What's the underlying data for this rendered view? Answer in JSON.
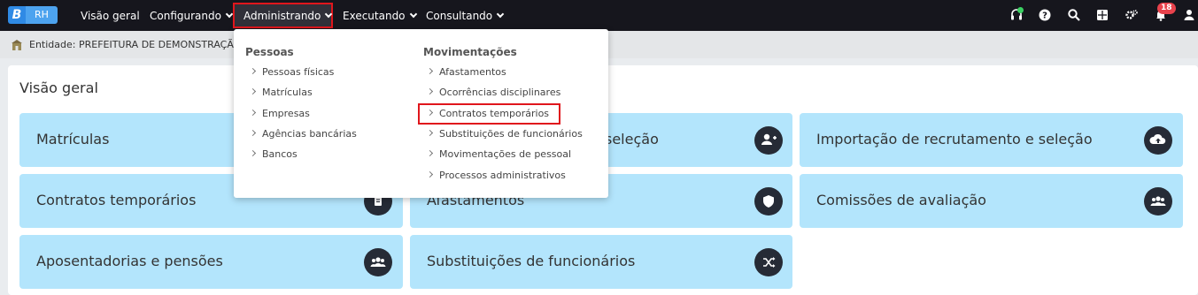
{
  "app": {
    "logo_letter": "B",
    "logo_label": "RH"
  },
  "nav": {
    "items": [
      {
        "label": "Visão geral"
      },
      {
        "label": "Configurando"
      },
      {
        "label": "Administrando"
      },
      {
        "label": "Executando"
      },
      {
        "label": "Consultando"
      }
    ]
  },
  "topbar": {
    "notification_count": "18",
    "icons": [
      "headset-icon",
      "help-icon",
      "search-icon",
      "apps-icon",
      "settings-icon",
      "bell-icon",
      "user-icon"
    ]
  },
  "entity": {
    "label": "Entidade: PREFEITURA DE DEMONSTRAÇÃO I"
  },
  "main": {
    "title": "Visão geral"
  },
  "cards": [
    {
      "label": "Matrículas",
      "icon": "user-icon"
    },
    {
      "label": "seleção",
      "icon": "user-plus-icon"
    },
    {
      "label": "Importação de recrutamento e seleção",
      "icon": "cloud-upload-icon"
    },
    {
      "label": "Contratos temporários",
      "icon": "document-icon"
    },
    {
      "label": "Afastamentos",
      "icon": "shield-icon"
    },
    {
      "label": "Comissões de avaliação",
      "icon": "users-icon"
    },
    {
      "label": "Aposentadorias e pensões",
      "icon": "users-icon"
    },
    {
      "label": "Substituições de funcionários",
      "icon": "shuffle-icon"
    }
  ],
  "dropdown": {
    "pessoas": {
      "title": "Pessoas",
      "items": [
        "Pessoas físicas",
        "Matrículas",
        "Empresas",
        "Agências bancárias",
        "Bancos"
      ]
    },
    "movimentacoes": {
      "title": "Movimentações",
      "items": [
        "Afastamentos",
        "Ocorrências disciplinares",
        "Contratos temporários",
        "Substituições de funcionários",
        "Movimentações de pessoal",
        "Processos administrativos"
      ]
    }
  }
}
